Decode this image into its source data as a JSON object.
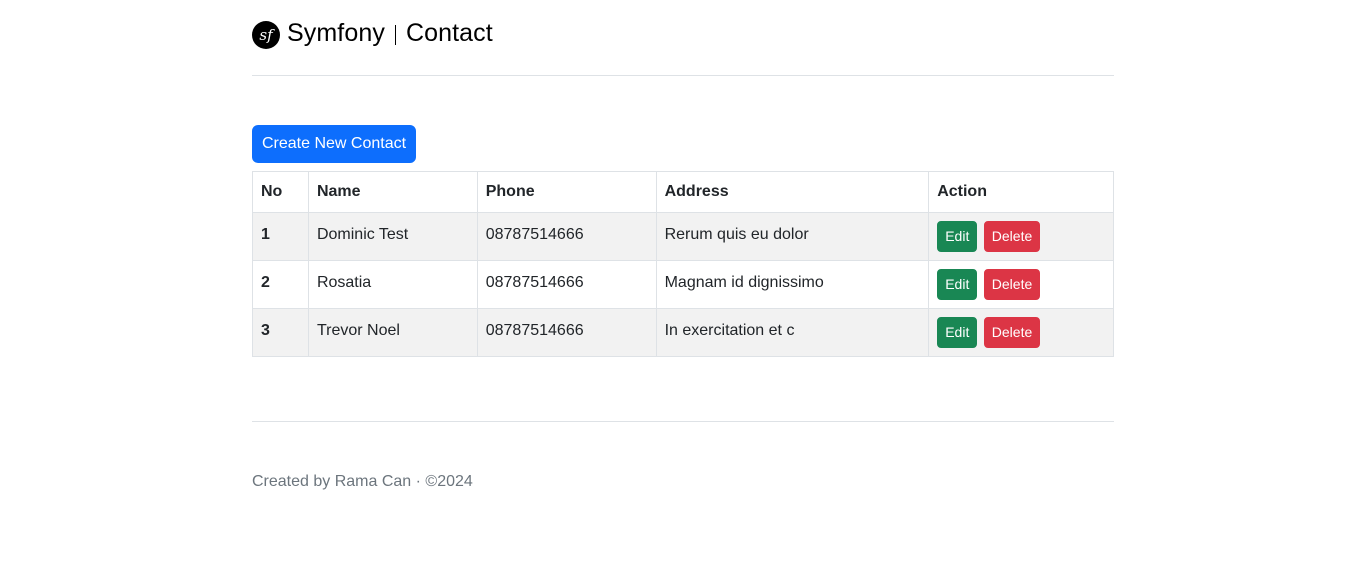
{
  "header": {
    "brand": "Symfony",
    "title": "Contact"
  },
  "toolbar": {
    "create_label": "Create New Contact"
  },
  "table": {
    "columns": [
      "No",
      "Name",
      "Phone",
      "Address",
      "Action"
    ],
    "rows": [
      {
        "no": "1",
        "name": "Dominic Test",
        "phone": "08787514666",
        "address": "Rerum quis eu dolor",
        "edit": "Edit",
        "delete": "Delete"
      },
      {
        "no": "2",
        "name": "Rosatia",
        "phone": "08787514666",
        "address": "Magnam id dignissimo",
        "edit": "Edit",
        "delete": "Delete"
      },
      {
        "no": "3",
        "name": "Trevor Noel",
        "phone": "08787514666",
        "address": "In exercitation et c",
        "edit": "Edit",
        "delete": "Delete"
      }
    ]
  },
  "footer": {
    "text": "Created by Rama Can · ©2024"
  },
  "colors": {
    "primary": "#0d6efd",
    "success": "#198754",
    "danger": "#dc3545",
    "stripe": "#f2f2f2",
    "muted": "#6c757d"
  },
  "icons": {
    "logo": "symfony-logo-icon"
  }
}
